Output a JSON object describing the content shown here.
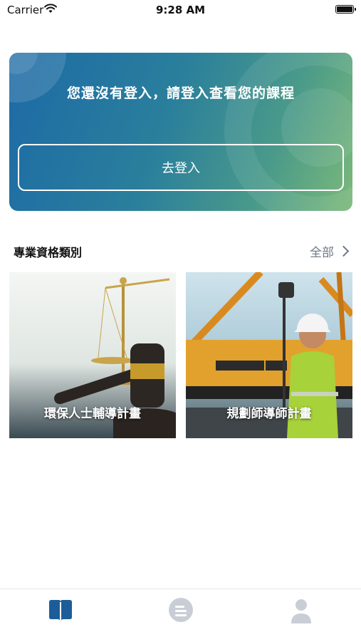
{
  "status_bar": {
    "carrier": "Carrier",
    "time": "9:28 AM"
  },
  "login_banner": {
    "message": "您還沒有登入，請登入查看您的課程",
    "button_label": "去登入"
  },
  "category_section": {
    "title": "專業資格類別",
    "view_all_label": "全部"
  },
  "cards": [
    {
      "label": "環保人士輔導計畫"
    },
    {
      "label": "規劃師導師計畫"
    }
  ],
  "tab_bar": {
    "icons": [
      "book-icon",
      "chat-icon",
      "profile-icon"
    ],
    "active_color": "#1c5d99",
    "inactive_color": "#c9ced6"
  },
  "colors": {
    "banner_start": "#1d6aa6",
    "banner_end": "#7cb97a"
  }
}
